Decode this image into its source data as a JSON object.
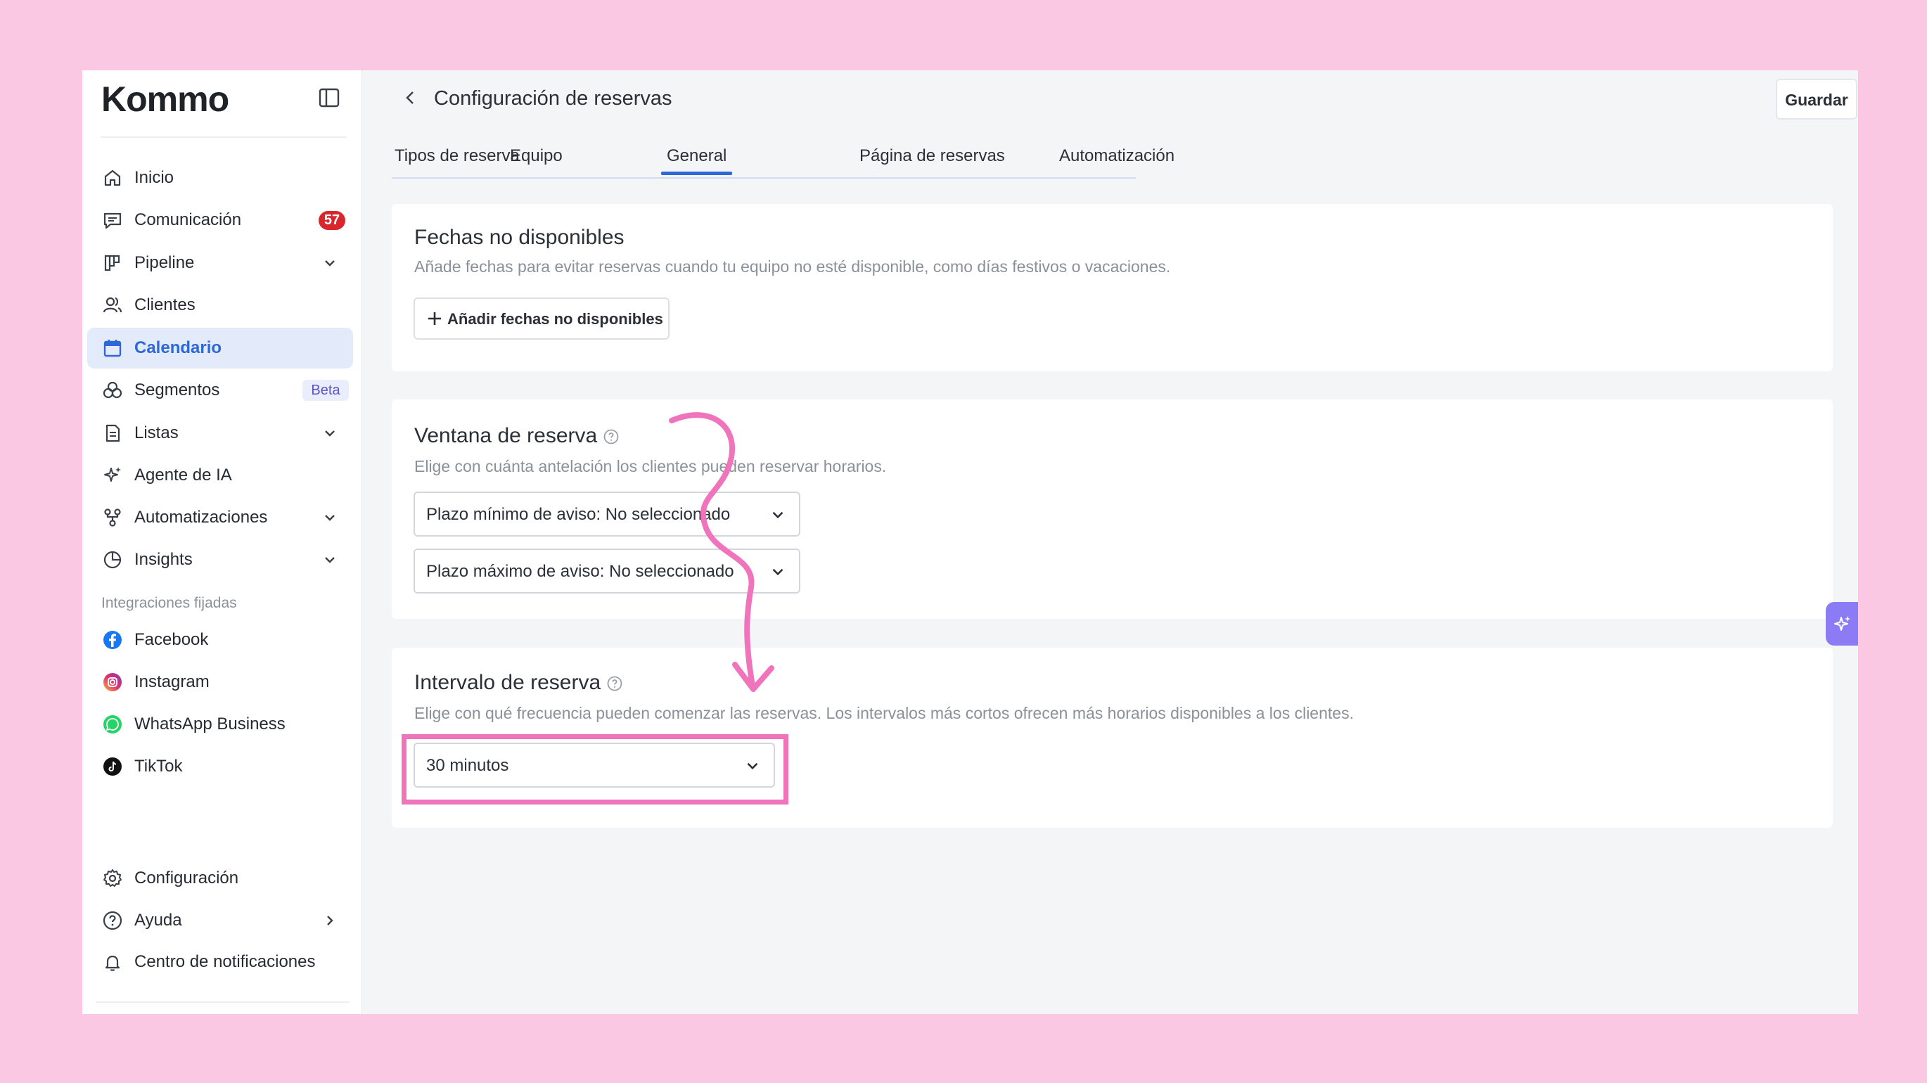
{
  "sidebar": {
    "logo": "Kommo",
    "items": [
      {
        "label": "Inicio",
        "icon": "home-icon"
      },
      {
        "label": "Comunicación",
        "icon": "chat-icon",
        "badge": "57"
      },
      {
        "label": "Pipeline",
        "icon": "pipeline-icon",
        "has_chevron": true
      },
      {
        "label": "Clientes",
        "icon": "users-icon"
      },
      {
        "label": "Calendario",
        "icon": "calendar-icon",
        "active": true
      },
      {
        "label": "Segmentos",
        "icon": "segments-icon",
        "badge": "Beta"
      },
      {
        "label": "Listas",
        "icon": "list-icon",
        "has_chevron": true
      },
      {
        "label": "Agente de IA",
        "icon": "sparkle-icon"
      },
      {
        "label": "Automatizaciones",
        "icon": "automation-icon",
        "has_chevron": true
      },
      {
        "label": "Insights",
        "icon": "chart-pie-icon",
        "has_chevron": true
      }
    ],
    "pinned_section_label": "Integraciones fijadas",
    "pinned": [
      {
        "label": "Facebook",
        "icon": "facebook-icon"
      },
      {
        "label": "Instagram",
        "icon": "instagram-icon"
      },
      {
        "label": "WhatsApp Business",
        "icon": "whatsapp-icon"
      },
      {
        "label": "TikTok",
        "icon": "tiktok-icon"
      }
    ],
    "bottom": [
      {
        "label": "Configuración",
        "icon": "gear-icon"
      },
      {
        "label": "Ayuda",
        "icon": "help-icon",
        "has_chevron": true
      },
      {
        "label": "Centro de notificaciones",
        "icon": "bell-icon"
      }
    ]
  },
  "header": {
    "title": "Configuración de reservas",
    "save_label": "Guardar"
  },
  "tabs": [
    {
      "label": "Tipos de reserva"
    },
    {
      "label": "Equipo"
    },
    {
      "label": "General",
      "active": true
    },
    {
      "label": "Página de reservas"
    },
    {
      "label": "Automatización"
    }
  ],
  "unavailable_dates": {
    "title": "Fechas no disponibles",
    "description": "Añade fechas para evitar reservas cuando tu equipo no esté disponible, como días festivos o vacaciones.",
    "add_button": "Añadir fechas no disponibles"
  },
  "booking_window": {
    "title": "Ventana de reserva",
    "description": "Elige con cuánta antelación los clientes pueden reservar horarios.",
    "min_notice": "Plazo mínimo de aviso: No seleccionado",
    "max_notice": "Plazo máximo de aviso: No seleccionado"
  },
  "booking_interval": {
    "title": "Intervalo de reserva",
    "description": "Elige con qué frecuencia pueden comenzar las reservas. Los intervalos más cortos ofrecen más horarios disponibles a los clientes.",
    "selected": "30 minutos"
  },
  "colors": {
    "accent": "#2e68d6",
    "annotation": "#f074bb",
    "background": "#fac8e2",
    "badge": "#d8262c"
  }
}
